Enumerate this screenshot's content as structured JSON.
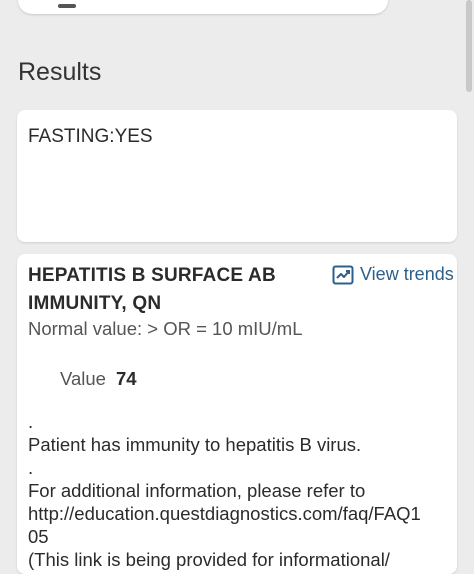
{
  "section": {
    "title": "Results"
  },
  "note_card": {
    "text": "FASTING:YES"
  },
  "result": {
    "title_line1": "HEPATITIS B SURFACE AB",
    "title_line2": "IMMUNITY, QN",
    "view_trends_label": "View trends",
    "view_trends_icon": "trend-chart-icon",
    "normal_value": "Normal value: > OR = 10 mIU/mL",
    "value_label": "Value",
    "value": "74",
    "comment_lines": [
      ".",
      "Patient has immunity to hepatitis B virus.",
      ".",
      "For additional information, please refer to",
      "http://education.questdiagnostics.com/faq/FAQ1",
      "05",
      "(This link is being provided for informational/"
    ]
  },
  "colors": {
    "link": "#2d5f8b",
    "background": "#ececec"
  }
}
